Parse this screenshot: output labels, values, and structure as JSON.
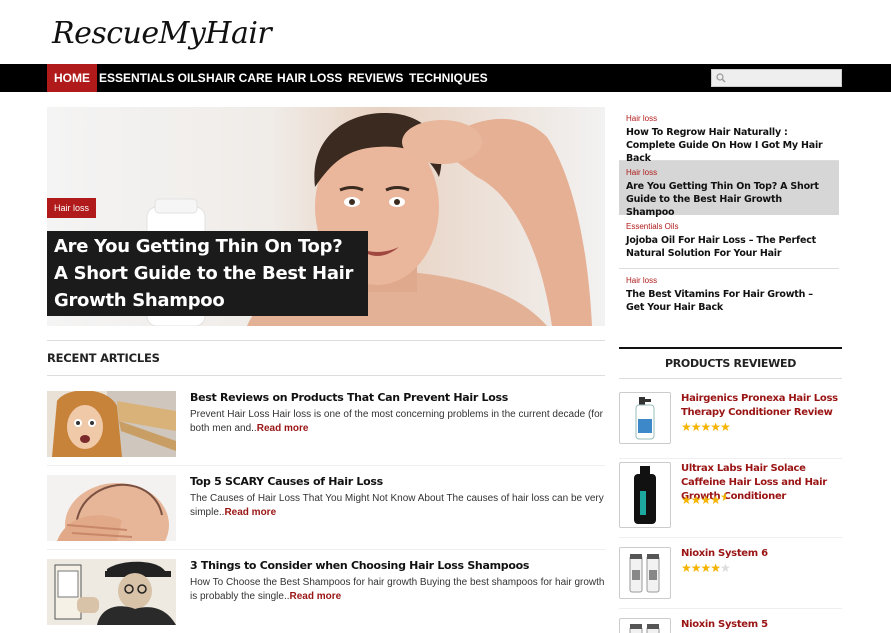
{
  "site": {
    "logo_text": "RescueMyHair"
  },
  "nav": {
    "items": [
      {
        "label": "HOME",
        "active": true
      },
      {
        "label": "ESSENTIALS OILS",
        "active": false
      },
      {
        "label": "HAIR CARE",
        "active": false
      },
      {
        "label": "HAIR LOSS",
        "active": false
      },
      {
        "label": "REVIEWS",
        "active": false
      },
      {
        "label": "TECHNIQUES",
        "active": false
      }
    ]
  },
  "hero": {
    "category": "Hair loss",
    "title": "Are You Getting Thin On Top? A Short Guide to the Best Hair Growth Shampoo"
  },
  "sidebar_posts": [
    {
      "category": "Hair loss",
      "title": "How To Regrow Hair Naturally : Complete Guide On How I Got My Hair Back",
      "highlighted": false
    },
    {
      "category": "Hair loss",
      "title": "Are You Getting Thin On Top? A Short Guide to the Best Hair Growth Shampoo",
      "highlighted": true
    },
    {
      "category": "Essentials Oils",
      "title": "Jojoba Oil For Hair Loss – The Perfect Natural Solution For Your Hair",
      "highlighted": false
    },
    {
      "category": "Hair loss",
      "title": "The Best Vitamins For Hair Growth – Get Your Hair Back",
      "highlighted": false
    }
  ],
  "recent": {
    "heading": "RECENT ARTICLES",
    "read_more": "Read more",
    "articles": [
      {
        "title": "Best Reviews on Products That Can Prevent Hair Loss",
        "excerpt": "Prevent Hair Loss Hair loss is one of the most concerning problems in the current decade (for both men and.."
      },
      {
        "title": "Top 5 SCARY Causes of Hair Loss",
        "excerpt": "The Causes of Hair Loss That You Might Not Know About The causes of hair loss can be very simple.."
      },
      {
        "title": "3 Things to Consider when Choosing Hair Loss Shampoos",
        "excerpt": "How To Choose the Best Shampoos for hair growth Buying the best shampoos for hair growth is probably the single.."
      }
    ]
  },
  "products": {
    "heading": "PRODUCTS REVIEWED",
    "items": [
      {
        "name": "Hairgenics Pronexa Hair Loss Therapy Conditioner Review",
        "rating": 5
      },
      {
        "name": "Ultrax Labs Hair Solace Caffeine Hair Loss and Hair Growth Conditioner",
        "rating": 4.5
      },
      {
        "name": "Nioxin System 6",
        "rating": 4
      },
      {
        "name": "Nioxin System 5",
        "rating": null
      }
    ]
  },
  "colors": {
    "accent": "#b01a1a",
    "nav_bg": "#000000",
    "star": "#f5b400"
  }
}
